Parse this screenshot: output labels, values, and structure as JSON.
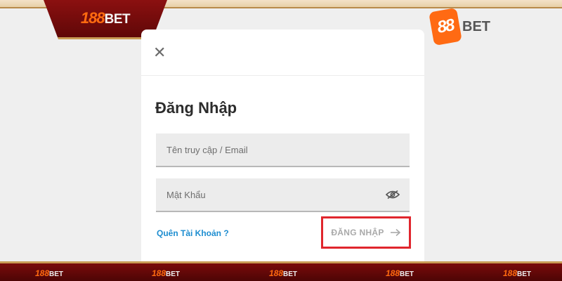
{
  "brand": {
    "tab_logo_num": "188",
    "tab_logo_word": "BET",
    "watermark_num": "88",
    "watermark_word": "BET"
  },
  "modal": {
    "close_symbol": "✕",
    "title": "Đăng Nhập",
    "username_placeholder": "Tên truy cập / Email",
    "password_placeholder": "Mật Khẩu",
    "forgot_link": "Quên Tài Khoản ?",
    "login_button": "ĐĂNG NHẬP"
  },
  "footer_logos": [
    {
      "num": "188",
      "word": "BET"
    },
    {
      "num": "188",
      "word": "BET"
    },
    {
      "num": "188",
      "word": "BET"
    },
    {
      "num": "188",
      "word": "BET"
    },
    {
      "num": "188",
      "word": "BET"
    }
  ],
  "colors": {
    "accent_orange": "#ff6b10",
    "highlight_red": "#e0262d",
    "link_blue": "#1d8dd0",
    "banner_red": "#7a0b0b"
  },
  "icons": {
    "close": "close-icon",
    "password_toggle": "eye-icon",
    "login_arrow": "arrow-right-icon"
  }
}
